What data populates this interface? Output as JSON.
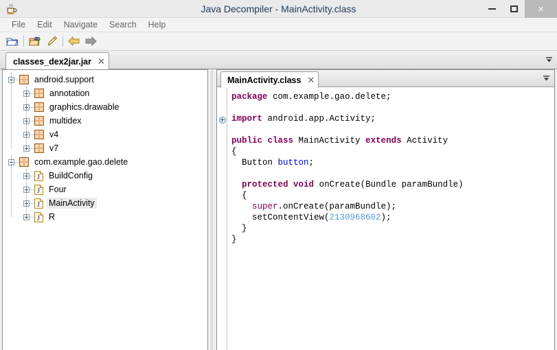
{
  "window": {
    "title": "Java Decompiler - MainActivity.class",
    "app_icon": "java-coffee-cup-icon",
    "minimize_label": "–",
    "maximize_label": "□",
    "close_label": "×",
    "close_bg": "#b9b9b9"
  },
  "menubar": {
    "items": [
      {
        "label": "File",
        "name": "menu-file"
      },
      {
        "label": "Edit",
        "name": "menu-edit"
      },
      {
        "label": "Navigate",
        "name": "menu-navigate"
      },
      {
        "label": "Search",
        "name": "menu-search"
      },
      {
        "label": "Help",
        "name": "menu-help"
      }
    ]
  },
  "toolbar": {
    "buttons": [
      {
        "icon": "open-folder-icon",
        "name": "open-file-button"
      },
      {
        "icon": "open-type-folder-icon",
        "name": "open-type-button"
      },
      {
        "icon": "pen-highlighter-icon",
        "name": "search-highlight-button"
      },
      {
        "icon": "arrow-left-icon",
        "name": "navigate-back-button"
      },
      {
        "icon": "arrow-right-icon",
        "name": "navigate-forward-button"
      }
    ]
  },
  "outer_tabs": {
    "chevron_icon": "chevron-down-icon",
    "items": [
      {
        "label": "classes_dex2jar.jar",
        "close_label": "✕",
        "active": true
      }
    ]
  },
  "tree": {
    "nodes": [
      {
        "label": "android.support",
        "icon": "package-icon",
        "toggle": "minus",
        "depth": 0,
        "selected": false
      },
      {
        "label": "annotation",
        "icon": "package-icon",
        "toggle": "plus",
        "depth": 1,
        "selected": false
      },
      {
        "label": "graphics.drawable",
        "icon": "package-icon",
        "toggle": "plus",
        "depth": 1,
        "selected": false
      },
      {
        "label": "multidex",
        "icon": "package-icon",
        "toggle": "plus",
        "depth": 1,
        "selected": false
      },
      {
        "label": "v4",
        "icon": "package-icon",
        "toggle": "plus",
        "depth": 1,
        "selected": false
      },
      {
        "label": "v7",
        "icon": "package-icon",
        "toggle": "plus",
        "depth": 1,
        "selected": false
      },
      {
        "label": "com.example.gao.delete",
        "icon": "package-icon",
        "toggle": "minus",
        "depth": 0,
        "selected": false
      },
      {
        "label": "BuildConfig",
        "icon": "class-icon",
        "toggle": "plus",
        "depth": 1,
        "selected": false
      },
      {
        "label": "Four",
        "icon": "class-icon",
        "toggle": "plus",
        "depth": 1,
        "selected": false
      },
      {
        "label": "MainActivity",
        "icon": "class-icon",
        "toggle": "plus",
        "depth": 1,
        "selected": true
      },
      {
        "label": "R",
        "icon": "class-icon",
        "toggle": "plus",
        "depth": 1,
        "selected": false
      }
    ]
  },
  "editor": {
    "chevron_icon": "chevron-down-icon",
    "tabs": [
      {
        "label": "MainActivity.class",
        "close_label": "✕",
        "active": true
      }
    ],
    "fold_marker": "expand-fold-icon",
    "code_lines": [
      [
        {
          "t": "package",
          "c": "kw"
        },
        {
          "t": " com.example.gao.delete;",
          "c": ""
        }
      ],
      [],
      [
        {
          "t": "import",
          "c": "kw"
        },
        {
          "t": " android.app.Activity;",
          "c": ""
        }
      ],
      [],
      [
        {
          "t": "public",
          "c": "kw"
        },
        {
          "t": " ",
          "c": ""
        },
        {
          "t": "class",
          "c": "kw"
        },
        {
          "t": " MainActivity ",
          "c": ""
        },
        {
          "t": "extends",
          "c": "kw"
        },
        {
          "t": " Activity",
          "c": ""
        }
      ],
      [
        {
          "t": "{",
          "c": ""
        }
      ],
      [
        {
          "t": "  Button ",
          "c": ""
        },
        {
          "t": "button",
          "c": "fld"
        },
        {
          "t": ";",
          "c": ""
        }
      ],
      [],
      [
        {
          "t": "  ",
          "c": ""
        },
        {
          "t": "protected",
          "c": "kw"
        },
        {
          "t": " ",
          "c": ""
        },
        {
          "t": "void",
          "c": "kw"
        },
        {
          "t": " onCreate(Bundle paramBundle)",
          "c": ""
        }
      ],
      [
        {
          "t": "  {",
          "c": ""
        }
      ],
      [
        {
          "t": "    ",
          "c": ""
        },
        {
          "t": "super",
          "c": "sup"
        },
        {
          "t": ".onCreate(paramBundle);",
          "c": ""
        }
      ],
      [
        {
          "t": "    setContentView(",
          "c": ""
        },
        {
          "t": "2130968602",
          "c": "num"
        },
        {
          "t": ");",
          "c": ""
        }
      ],
      [
        {
          "t": "  }",
          "c": ""
        }
      ],
      [
        {
          "t": "}",
          "c": ""
        }
      ]
    ]
  },
  "colors": {
    "keyword": "#7f0055",
    "field": "#0000c0",
    "number": "#5599dd",
    "selection": "#ebebeb",
    "package_icon": "#d08030",
    "class_icon": "#c9a227"
  }
}
